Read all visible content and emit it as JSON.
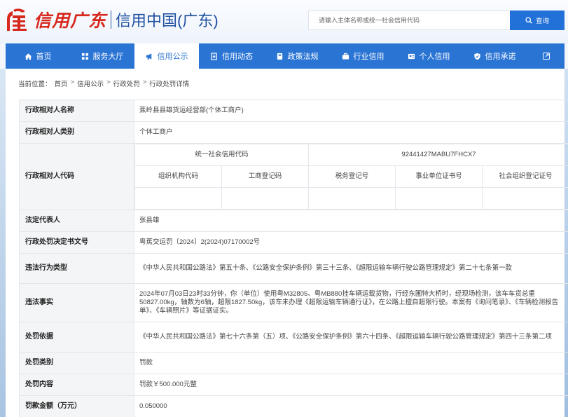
{
  "header": {
    "logo_script": "信用广东",
    "logo_text": "信用中国(广东)",
    "search_placeholder": "请输入主体名称或统一社会信用代码",
    "search_button": "查询"
  },
  "nav": [
    {
      "label": "首页",
      "icon": "home-icon"
    },
    {
      "label": "服务大厅",
      "icon": "grid-icon"
    },
    {
      "label": "信用公示",
      "icon": "megaphone-icon",
      "active": true
    },
    {
      "label": "信用动态",
      "icon": "document-icon"
    },
    {
      "label": "政策法规",
      "icon": "book-icon"
    },
    {
      "label": "行业信用",
      "icon": "briefcase-icon"
    },
    {
      "label": "个人信用",
      "icon": "id-card-icon"
    },
    {
      "label": "信用承诺",
      "icon": "shield-check-icon"
    },
    {
      "label": "",
      "icon": "exit-icon"
    }
  ],
  "breadcrumb": {
    "prefix": "当前位置：",
    "items": [
      "首页",
      "信用公示",
      "行政处罚",
      "行政处罚详情"
    ]
  },
  "record": {
    "name_label": "行政相对人名称",
    "name_value": "蕉岭县县雄货运经营部(个体工商户)",
    "type_label": "行政相对人类别",
    "type_value": "个体工商户",
    "code_label": "行政相对人代码",
    "uscc_label": "统一社会信用代码",
    "uscc_value": "92441427MABU7FHCX7",
    "code_headers": [
      "组织机构代码",
      "工商登记码",
      "税务登记号",
      "事业单位证书号",
      "社会组织登记证号"
    ],
    "legal_label": "法定代表人",
    "legal_value": "张县雄",
    "doc_label": "行政处罚决定书文号",
    "doc_value": "粤蕉交运罚〔2024〕2(2024)07170002号",
    "violation_type_label": "违法行为类型",
    "violation_type_value": "《中华人民共和国公路法》第五十条、《公路安全保护条例》第三十三条、《超限运输车辆行驶公路管理规定》第二十七条第一款",
    "facts_label": "违法事实",
    "facts_value": "2024年07月03日23时33分钟，你（单位）使用粤M32805、粤MB880挂车辆运载货物，行经东圃特大桥时，经现场检测，该车车货总重50827.00kg，轴数为6轴，超限1827.50kg，该车未办理《超限运输车辆通行证》，在公路上擅自超限行驶。本案有《询问笔录》、《车辆检测报告单》、《车辆照片》等证据证实。",
    "basis_label": "处罚依据",
    "basis_value": "《中华人民共和国公路法》第七十六条第（五）项、《公路安全保护条例》第六十四条、《超限运输车辆行驶公路管理规定》第四十三条第二项",
    "category_label": "处罚类别",
    "category_value": "罚款",
    "content_label": "处罚内容",
    "content_value": "罚款￥500.000元整",
    "amount_label": "罚款金额（万元）",
    "amount_value": "0.050000"
  }
}
